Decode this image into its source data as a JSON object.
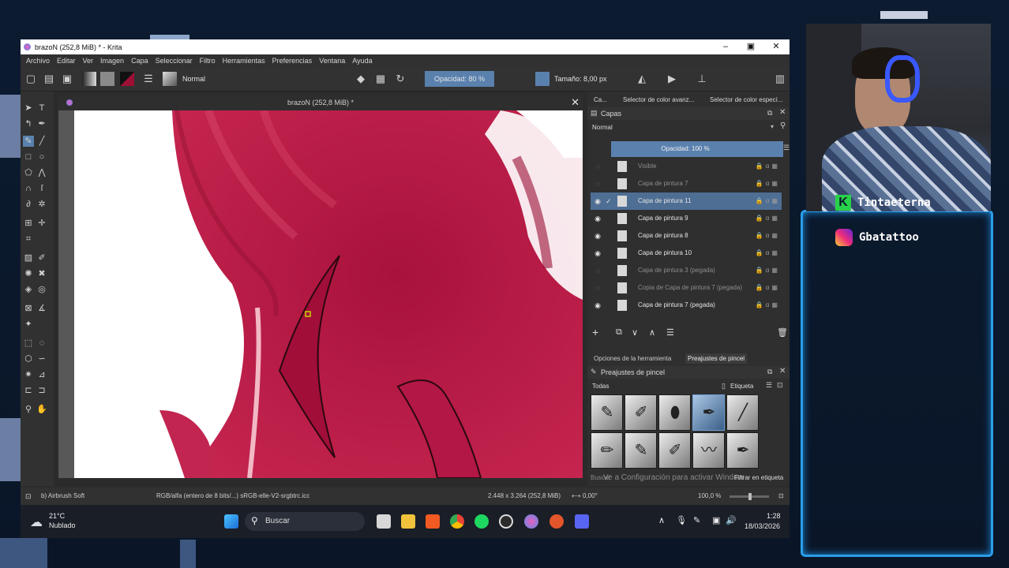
{
  "window": {
    "title": "brazoN (252,8 MiB) * - Krita"
  },
  "menu": [
    "Archivo",
    "Editar",
    "Ver",
    "Imagen",
    "Capa",
    "Seleccionar",
    "Filtro",
    "Herramientas",
    "Preferencias",
    "Ventana",
    "Ayuda"
  ],
  "toolbar": {
    "blend_mode": "Normal",
    "opacity": "Opacidad: 80 %",
    "size": "Tamaño: 8,00 px"
  },
  "document": {
    "title": "brazoN (252,8 MiB) *"
  },
  "dock": {
    "tabs": [
      "Ca...",
      "Selector de color avanz...",
      "Selector de color especí..."
    ],
    "layers_title": "Capas",
    "blend_mode": "Normal",
    "opacity": "Opacidad: 100 %",
    "layers": [
      {
        "name": "Visible",
        "visible": false,
        "selected": false
      },
      {
        "name": "Capa de pintura 7",
        "visible": false,
        "selected": false
      },
      {
        "name": "Capa de pintura 11",
        "visible": true,
        "selected": true
      },
      {
        "name": "Capa de pintura 9",
        "visible": true,
        "selected": false
      },
      {
        "name": "Capa de pintura 8",
        "visible": true,
        "selected": false
      },
      {
        "name": "Capa de pintura 10",
        "visible": true,
        "selected": false
      },
      {
        "name": "Capa de pintura 3 (pegada)",
        "visible": false,
        "selected": false
      },
      {
        "name": "Copia de Capa de pintura 7 (pegada)",
        "visible": false,
        "selected": false
      },
      {
        "name": "Capa de pintura 7 (pegada)",
        "visible": true,
        "selected": false
      }
    ],
    "lower_tabs": [
      "Opciones de la herramienta",
      "Preajustes de pincel"
    ],
    "presets_title": "Preajustes de pincel",
    "presets_filter": "Todas",
    "presets_tag": "Etiqueta",
    "search_placeholder": "Buscar",
    "filter_tag": "Filtrar en etiqueta",
    "activation_watermark": "Ve a Configuración para activar Windows."
  },
  "status": {
    "brush": "b) Airbrush Soft",
    "color_profile": "RGB/alfa (entero de 8 bits/...)  sRGB-elle-V2-srgbtrc.icc",
    "dimensions": "2.448 x 3.264 (252,8 MiB)",
    "rotation": "0,00°",
    "zoom": "100,0 %"
  },
  "taskbar": {
    "weather_temp": "21°C",
    "weather_desc": "Nublado",
    "search_label": "Buscar",
    "time": "1:28",
    "date": "18/03/2026"
  },
  "stream": {
    "cam_name": "Tintaeterna",
    "instagram": "Gbatattoo"
  }
}
